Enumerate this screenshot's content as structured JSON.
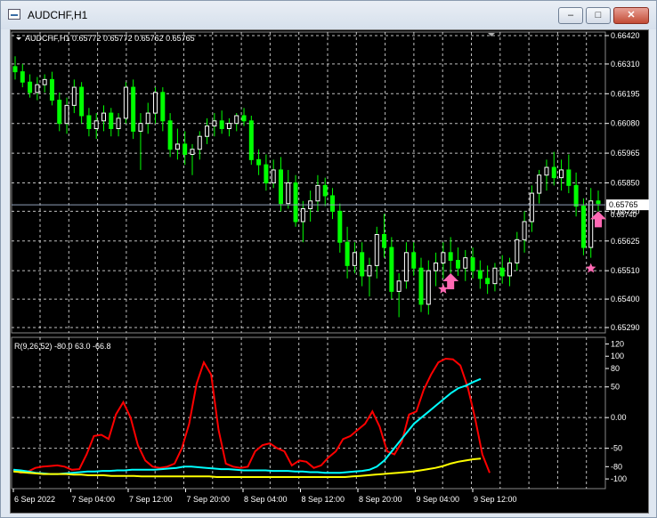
{
  "window": {
    "title": "AUDCHF,H1",
    "minimize_glyph": "–",
    "maximize_glyph": "□",
    "close_glyph": "✕"
  },
  "price_panel": {
    "header": "AUDCHF,H1  0.65772 0.65772 0.65762 0.65765",
    "current_price_label": "0.65765",
    "secondary_price_label": "0.65740",
    "price_ticks": [
      "0.66420",
      "0.66310",
      "0.66195",
      "0.66080",
      "0.65965",
      "0.65850",
      "0.65740",
      "0.65625",
      "0.65510",
      "0.65400",
      "0.65290"
    ]
  },
  "indicator_panel": {
    "header": "R(9,26,52) -80.0 63.0 -66.8",
    "ticks": [
      "120",
      "100",
      "80",
      "50",
      "0.00",
      "-50",
      "-80",
      "-100"
    ]
  },
  "time_axis": {
    "labels": [
      "6 Sep 2022",
      "7 Sep 04:00",
      "7 Sep 12:00",
      "7 Sep 20:00",
      "8 Sep 04:00",
      "8 Sep 12:00",
      "8 Sep 20:00",
      "9 Sep 04:00",
      "9 Sep 12:00"
    ]
  },
  "colors": {
    "background": "#000000",
    "grid": "#ffffff",
    "bull_candle": "#ffffff",
    "bear_candle": "#00ff00",
    "red_line": "#ff0000",
    "cyan_line": "#00ffff",
    "yellow_line": "#ffff00",
    "marker": "#ff69b4"
  },
  "chart_data": [
    {
      "type": "candlestick",
      "symbol": "AUDCHF",
      "timeframe": "H1",
      "ylim": [
        0.6529,
        0.6642
      ],
      "current_price": 0.65765,
      "candles_ohlc": [
        [
          0.663,
          0.6634,
          0.6625,
          0.6628
        ],
        [
          0.6628,
          0.6631,
          0.6622,
          0.6624
        ],
        [
          0.6624,
          0.6627,
          0.6618,
          0.662
        ],
        [
          0.662,
          0.6626,
          0.6617,
          0.6623
        ],
        [
          0.6623,
          0.6627,
          0.662,
          0.6625
        ],
        [
          0.6625,
          0.6628,
          0.6615,
          0.6617
        ],
        [
          0.6617,
          0.662,
          0.6605,
          0.6608
        ],
        [
          0.6608,
          0.6618,
          0.6604,
          0.6615
        ],
        [
          0.6615,
          0.6625,
          0.6612,
          0.6622
        ],
        [
          0.6622,
          0.6624,
          0.6608,
          0.6611
        ],
        [
          0.6611,
          0.6614,
          0.6603,
          0.6606
        ],
        [
          0.6606,
          0.6612,
          0.6602,
          0.6609
        ],
        [
          0.6609,
          0.6615,
          0.6605,
          0.6612
        ],
        [
          0.6612,
          0.6614,
          0.6603,
          0.6606
        ],
        [
          0.6606,
          0.6612,
          0.6603,
          0.661
        ],
        [
          0.661,
          0.6624,
          0.6608,
          0.6622
        ],
        [
          0.6622,
          0.6625,
          0.6602,
          0.6605
        ],
        [
          0.6605,
          0.6612,
          0.659,
          0.6608
        ],
        [
          0.6608,
          0.6616,
          0.6604,
          0.6612
        ],
        [
          0.6612,
          0.6622,
          0.6608,
          0.662
        ],
        [
          0.662,
          0.6622,
          0.6605,
          0.6609
        ],
        [
          0.6609,
          0.6612,
          0.6595,
          0.6598
        ],
        [
          0.6598,
          0.6606,
          0.6594,
          0.66
        ],
        [
          0.66,
          0.6605,
          0.6592,
          0.6596
        ],
        [
          0.6596,
          0.66,
          0.6588,
          0.6598
        ],
        [
          0.6598,
          0.6605,
          0.6594,
          0.6603
        ],
        [
          0.6603,
          0.661,
          0.66,
          0.6607
        ],
        [
          0.6607,
          0.6612,
          0.6603,
          0.6609
        ],
        [
          0.6609,
          0.6613,
          0.6604,
          0.6606
        ],
        [
          0.6606,
          0.661,
          0.6603,
          0.6608
        ],
        [
          0.6608,
          0.6612,
          0.6605,
          0.6611
        ],
        [
          0.6611,
          0.6614,
          0.6607,
          0.6609
        ],
        [
          0.6609,
          0.6611,
          0.6592,
          0.6594
        ],
        [
          0.6594,
          0.6598,
          0.6588,
          0.6592
        ],
        [
          0.6592,
          0.6596,
          0.6582,
          0.6585
        ],
        [
          0.6585,
          0.6594,
          0.6583,
          0.659
        ],
        [
          0.659,
          0.6595,
          0.6574,
          0.6577
        ],
        [
          0.6577,
          0.659,
          0.6575,
          0.6585
        ],
        [
          0.6585,
          0.6588,
          0.6568,
          0.657
        ],
        [
          0.657,
          0.6578,
          0.6562,
          0.6575
        ],
        [
          0.6575,
          0.6582,
          0.657,
          0.6578
        ],
        [
          0.6578,
          0.6588,
          0.6574,
          0.6584
        ],
        [
          0.6584,
          0.6587,
          0.6576,
          0.658
        ],
        [
          0.658,
          0.6583,
          0.6571,
          0.6574
        ],
        [
          0.6574,
          0.6577,
          0.6558,
          0.6562
        ],
        [
          0.6562,
          0.6568,
          0.6548,
          0.6553
        ],
        [
          0.6553,
          0.6562,
          0.655,
          0.6558
        ],
        [
          0.6558,
          0.6562,
          0.6545,
          0.6549
        ],
        [
          0.6549,
          0.6556,
          0.6541,
          0.6553
        ],
        [
          0.6553,
          0.6568,
          0.6548,
          0.6565
        ],
        [
          0.6565,
          0.6573,
          0.6556,
          0.656
        ],
        [
          0.656,
          0.6564,
          0.654,
          0.6543
        ],
        [
          0.6543,
          0.655,
          0.6533,
          0.6547
        ],
        [
          0.6547,
          0.6562,
          0.6544,
          0.6558
        ],
        [
          0.6558,
          0.6562,
          0.6549,
          0.6552
        ],
        [
          0.6552,
          0.6556,
          0.6535,
          0.6538
        ],
        [
          0.6538,
          0.6555,
          0.6534,
          0.6551
        ],
        [
          0.6551,
          0.6558,
          0.6545,
          0.6554
        ],
        [
          0.6554,
          0.6562,
          0.6548,
          0.6558
        ],
        [
          0.6558,
          0.6564,
          0.655,
          0.6555
        ],
        [
          0.6555,
          0.656,
          0.6549,
          0.6552
        ],
        [
          0.6552,
          0.6559,
          0.6547,
          0.6556
        ],
        [
          0.6556,
          0.656,
          0.6548,
          0.6551
        ],
        [
          0.6551,
          0.6555,
          0.6544,
          0.6548
        ],
        [
          0.6548,
          0.6553,
          0.6542,
          0.6546
        ],
        [
          0.6546,
          0.6554,
          0.6543,
          0.6552
        ],
        [
          0.6552,
          0.6557,
          0.6546,
          0.6549
        ],
        [
          0.6549,
          0.6556,
          0.6545,
          0.6554
        ],
        [
          0.6554,
          0.6566,
          0.6551,
          0.6563
        ],
        [
          0.6563,
          0.6574,
          0.6558,
          0.657
        ],
        [
          0.657,
          0.6584,
          0.6566,
          0.6581
        ],
        [
          0.6581,
          0.659,
          0.6577,
          0.6588
        ],
        [
          0.6588,
          0.6594,
          0.6582,
          0.6591
        ],
        [
          0.6591,
          0.6597,
          0.6584,
          0.6587
        ],
        [
          0.6587,
          0.6594,
          0.6582,
          0.659
        ],
        [
          0.659,
          0.6596,
          0.6581,
          0.6584
        ],
        [
          0.6584,
          0.6589,
          0.6572,
          0.6576
        ],
        [
          0.6576,
          0.6579,
          0.6557,
          0.656
        ],
        [
          0.656,
          0.6583,
          0.6556,
          0.6578
        ],
        [
          0.6578,
          0.6582,
          0.6574,
          0.6577
        ]
      ],
      "markers": [
        {
          "type": "star",
          "candle": 58
        },
        {
          "type": "up-arrow",
          "candle": 59
        },
        {
          "type": "star",
          "candle": 78
        },
        {
          "type": "up-arrow",
          "candle": 79
        }
      ]
    },
    {
      "type": "line",
      "name": "R(9,26,52)",
      "ylim": [
        -110,
        125
      ],
      "series": [
        {
          "color": "#ff0000",
          "values": [
            -85,
            -90,
            -88,
            -82,
            -80,
            -79,
            -78,
            -80,
            -85,
            -84,
            -60,
            -30,
            -28,
            -35,
            5,
            25,
            0,
            -45,
            -70,
            -80,
            -82,
            -80,
            -75,
            -50,
            -10,
            55,
            90,
            70,
            -20,
            -75,
            -80,
            -82,
            -80,
            -55,
            -45,
            -42,
            -50,
            -55,
            -78,
            -70,
            -72,
            -82,
            -78,
            -65,
            -55,
            -35,
            -30,
            -20,
            -10,
            10,
            -15,
            -55,
            -60,
            -40,
            5,
            10,
            45,
            70,
            90,
            96,
            95,
            85,
            50,
            0,
            -60,
            -90
          ]
        },
        {
          "color": "#00ffff",
          "values": [
            -85,
            -86,
            -88,
            -90,
            -91,
            -92,
            -92,
            -91,
            -90,
            -89,
            -88,
            -88,
            -87,
            -87,
            -86,
            -86,
            -85,
            -85,
            -85,
            -85,
            -84,
            -83,
            -82,
            -80,
            -80,
            -81,
            -82,
            -83,
            -84,
            -84,
            -85,
            -86,
            -86,
            -86,
            -86,
            -87,
            -87,
            -87,
            -88,
            -88,
            -89,
            -89,
            -90,
            -90,
            -90,
            -89,
            -88,
            -87,
            -85,
            -80,
            -70,
            -55,
            -40,
            -25,
            -10,
            0,
            10,
            20,
            30,
            40,
            48,
            52,
            58,
            63
          ]
        },
        {
          "color": "#ffff00",
          "values": [
            -88,
            -89,
            -90,
            -91,
            -92,
            -92,
            -92,
            -92,
            -93,
            -93,
            -94,
            -94,
            -94,
            -95,
            -95,
            -95,
            -95,
            -96,
            -96,
            -96,
            -96,
            -96,
            -96,
            -96,
            -96,
            -96,
            -96,
            -97,
            -97,
            -97,
            -97,
            -97,
            -97,
            -97,
            -97,
            -97,
            -97,
            -97,
            -97,
            -97,
            -97,
            -97,
            -97,
            -97,
            -97,
            -96,
            -95,
            -94,
            -93,
            -92,
            -91,
            -90,
            -89,
            -88,
            -86,
            -84,
            -82,
            -79,
            -75,
            -72,
            -70,
            -68,
            -66.8
          ]
        }
      ]
    }
  ]
}
